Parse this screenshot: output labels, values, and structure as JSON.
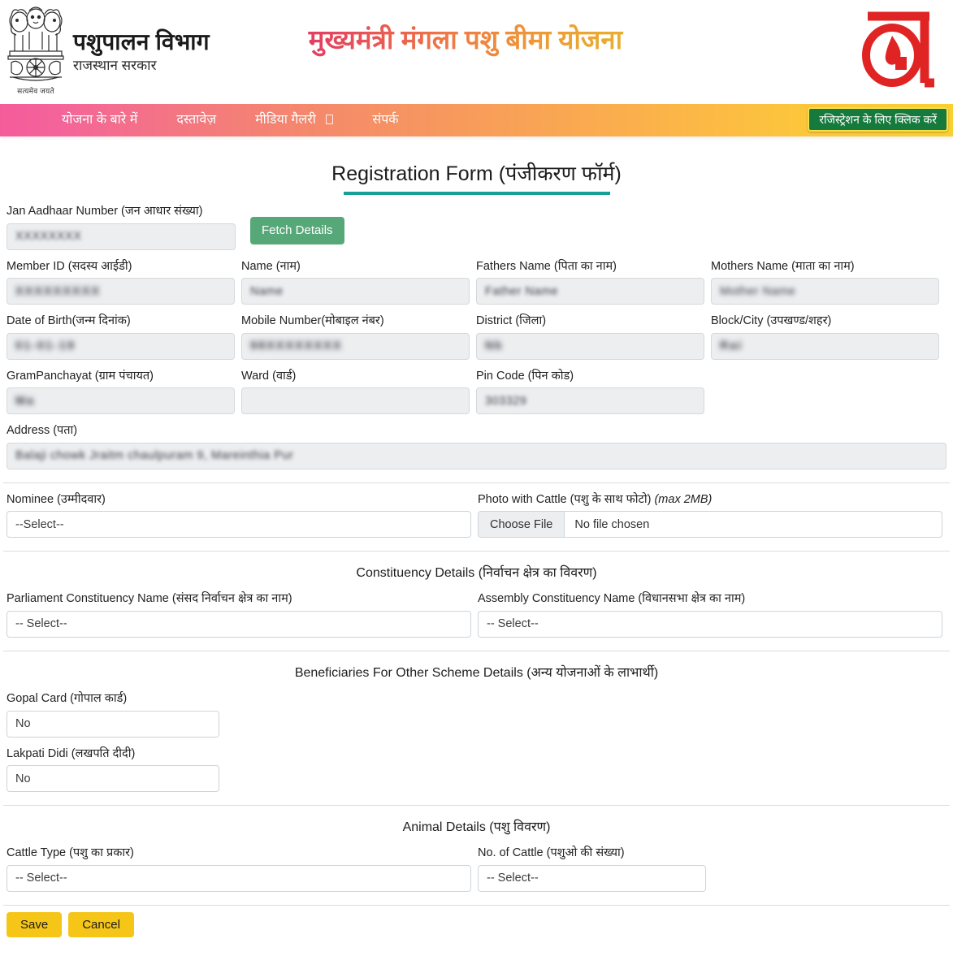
{
  "header": {
    "department_title": "पशुपालन विभाग",
    "department_subtitle": "राजस्थान सरकार",
    "emblem_motto": "सत्यमेव जयते",
    "scheme_title": "मुख्यमंत्री मंगला पशु बीमा योजना",
    "brand_logo_glyph": "व"
  },
  "nav": {
    "items": [
      {
        "label": "योजना के बारे में",
        "has_box": false
      },
      {
        "label": "दस्तावेज़",
        "has_box": false
      },
      {
        "label": "मीडिया गैलरी",
        "has_box": true
      },
      {
        "label": "संपर्क",
        "has_box": false
      }
    ],
    "register_button": "रजिस्ट्रेशन के लिए क्लिक करें",
    "gradient_start": "#f45b9a",
    "gradient_mid": "#f79a5c",
    "gradient_end": "#f9d02f",
    "register_bg": "#157a3c",
    "register_border": "#f9e04a"
  },
  "form": {
    "title_en": "Registration Form ",
    "title_hi": "(पंजीकरण फॉर्म)",
    "rule_color": "#17a098",
    "jan_aadhaar": {
      "label": "Jan Aadhaar Number (जन आधार संख्या)",
      "value": "XXXXXXXX",
      "fetch_button": "Fetch Details",
      "fetch_button_color": "#57a878"
    },
    "fields": {
      "member_id": {
        "label": "Member ID (सदस्य आईडी)",
        "value": "XXXXXXXXX"
      },
      "name": {
        "label": "Name (नाम)",
        "value": "Name"
      },
      "fathers_name": {
        "label": "Fathers Name (पिता का नाम)",
        "value": "Father Name"
      },
      "mothers_name": {
        "label": "Mothers Name (माता का नाम)",
        "value": "Mother Name"
      },
      "dob": {
        "label": "Date of Birth(जन्म दिनांक)",
        "value": "01-01-19"
      },
      "mobile": {
        "label": "Mobile Number(मोबाइल नंबर)",
        "value": "98XXXXXXXX"
      },
      "district": {
        "label": "District (जिला)",
        "value": "Nk"
      },
      "block_city": {
        "label": "Block/City (उपखण्ड/शहर)",
        "value": "Rai"
      },
      "gram_panchayat": {
        "label": "GramPanchayat (ग्राम पंचायत)",
        "value": "Ma"
      },
      "ward": {
        "label": "Ward (वार्ड)",
        "value": ""
      },
      "pin_code": {
        "label": "Pin Code (पिन कोड)",
        "value": "303329"
      },
      "address": {
        "label": "Address (पता)",
        "value": "Balaji chowk Jraitm chaulpuram 9, Mareinthia  Pur"
      }
    },
    "nominee": {
      "label": "Nominee (उम्मीदवार)",
      "value": "--Select--"
    },
    "photo_with_cattle": {
      "label_main": "Photo with Cattle (पशु के साथ फोटो) ",
      "label_note": "(max 2MB)",
      "choose_file": "Choose File",
      "file_status": "No file chosen"
    },
    "constituency": {
      "section_title": "Constituency Details (निर्वाचन क्षेत्र का विवरण)",
      "parliament": {
        "label": "Parliament Constituency Name (संसद निर्वाचन क्षेत्र का नाम)",
        "value": "-- Select--"
      },
      "assembly": {
        "label": "Assembly Constituency Name (विधानसभा क्षेत्र का नाम)",
        "value": "-- Select--"
      }
    },
    "other_schemes": {
      "section_title": "Beneficiaries For Other Scheme Details (अन्य योजनाओं के लाभार्थी)",
      "gopal_card": {
        "label": "Gopal Card (गोपाल कार्ड)",
        "value": "No"
      },
      "lakpati_didi": {
        "label": "Lakpati Didi (लखपति दीदी)",
        "value": "No"
      }
    },
    "animal_details": {
      "section_title": "Animal Details (पशु विवरण)",
      "cattle_type": {
        "label": "Cattle Type (पशु का प्रकार)",
        "value": "-- Select--"
      },
      "no_of_cattle": {
        "label": "No. of Cattle (पशुओ की संख्या)",
        "value": "-- Select--"
      }
    },
    "actions": {
      "save": "Save",
      "cancel": "Cancel",
      "button_color": "#f5c518"
    }
  }
}
